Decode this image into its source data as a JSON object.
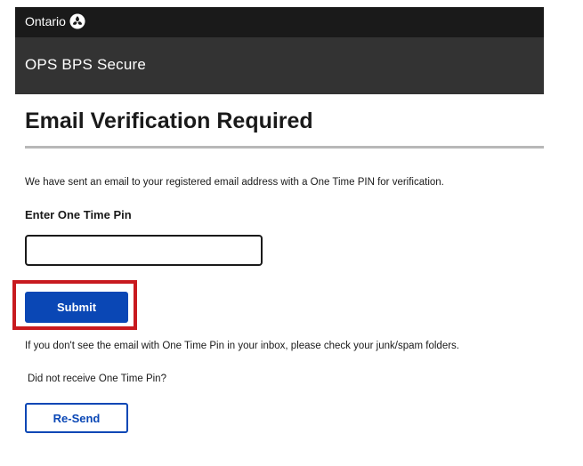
{
  "header": {
    "brand_text": "Ontario",
    "brand_icon": "trillium-logo",
    "app_title": "OPS BPS Secure"
  },
  "main": {
    "page_title": "Email Verification Required",
    "info_text": "We have sent an email to your registered email address with a One Time PIN for verification.",
    "pin_field": {
      "label": "Enter One Time Pin",
      "value": "",
      "placeholder": ""
    },
    "submit_label": "Submit",
    "spam_notice": "If you don't see the email with One Time Pin in your inbox, please check your junk/spam folders.",
    "not_received_text": "Did not receive One Time Pin?",
    "resend_label": "Re-Send"
  },
  "colors": {
    "topbar": "#1a1a1a",
    "appbar": "#333333",
    "primary": "#0a47b5",
    "highlight": "#c81a1f"
  }
}
